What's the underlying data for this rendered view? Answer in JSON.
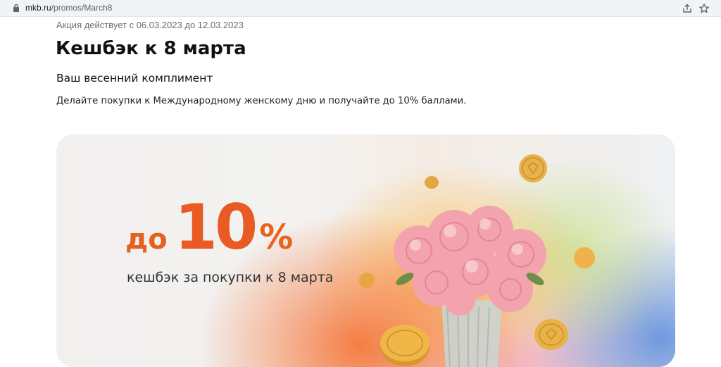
{
  "browser": {
    "url_host": "mkb.ru",
    "url_path": "/promos/March8",
    "icons": [
      "lock-icon",
      "share-icon",
      "star-icon"
    ]
  },
  "page": {
    "dates": "Акция действует с 06.03.2023 до 12.03.2023",
    "title": "Кешбэк к 8 марта",
    "subtitle": "Ваш весенний комплимент",
    "description": "Делайте покупки к Международному женскому дню и получайте до 10% баллами."
  },
  "banner": {
    "prefix": "до",
    "number": "10",
    "percent": "%",
    "caption": "кешбэк за покупки к 8 марта"
  },
  "colors": {
    "accent_orange": "#e95a24",
    "text_dark": "#111111",
    "text_muted": "#6b6b6b"
  }
}
